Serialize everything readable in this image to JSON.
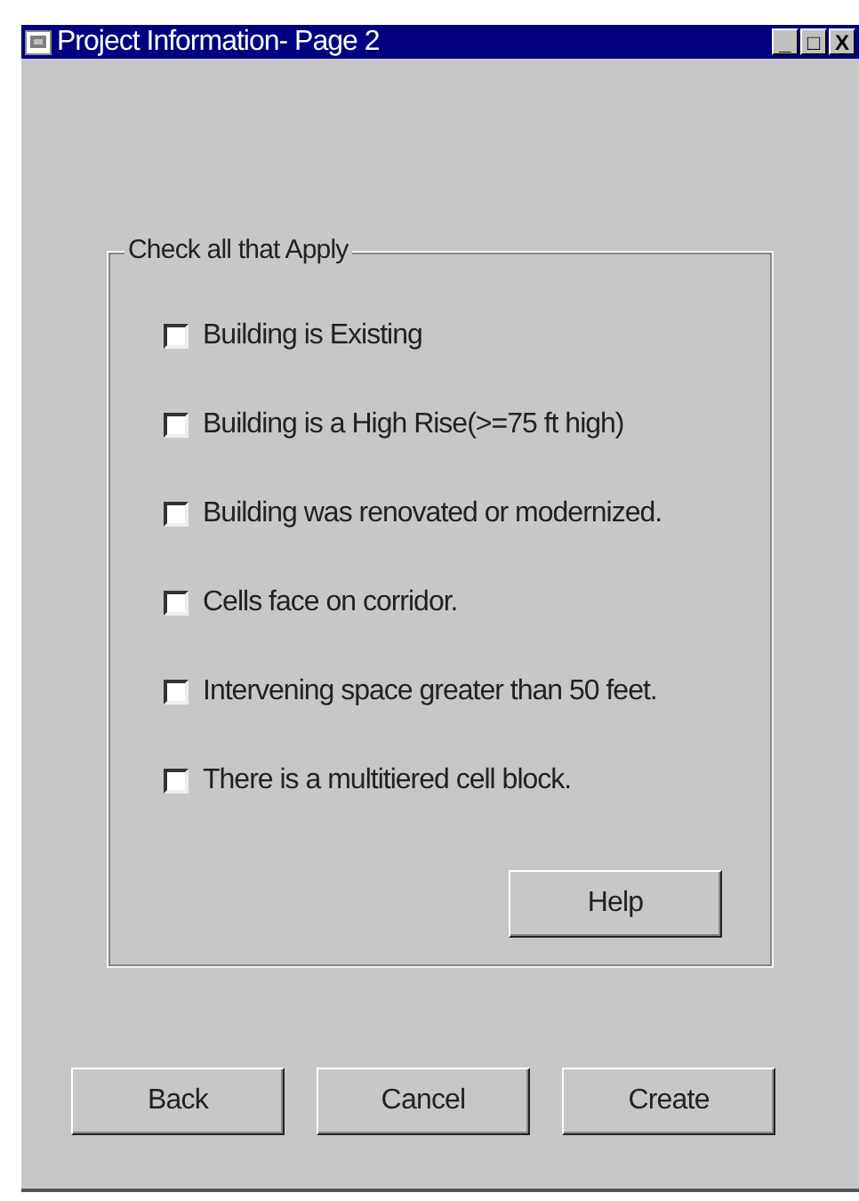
{
  "window": {
    "title": "Project Information- Page 2",
    "controls": [
      "_",
      "□",
      "X"
    ]
  },
  "group": {
    "title": "Check all that Apply",
    "items": [
      {
        "label": "Building is Existing",
        "checked": false
      },
      {
        "label": "Building is a High Rise(>=75 ft high)",
        "checked": false
      },
      {
        "label": "Building was renovated or modernized.",
        "checked": false
      },
      {
        "label": "Cells face on corridor.",
        "checked": false
      },
      {
        "label": "Intervening space greater than 50 feet.",
        "checked": false
      },
      {
        "label": "There is a multitiered cell block.",
        "checked": false
      }
    ],
    "help_button": "Help"
  },
  "buttons": [
    "Back",
    "Cancel",
    "Create"
  ]
}
